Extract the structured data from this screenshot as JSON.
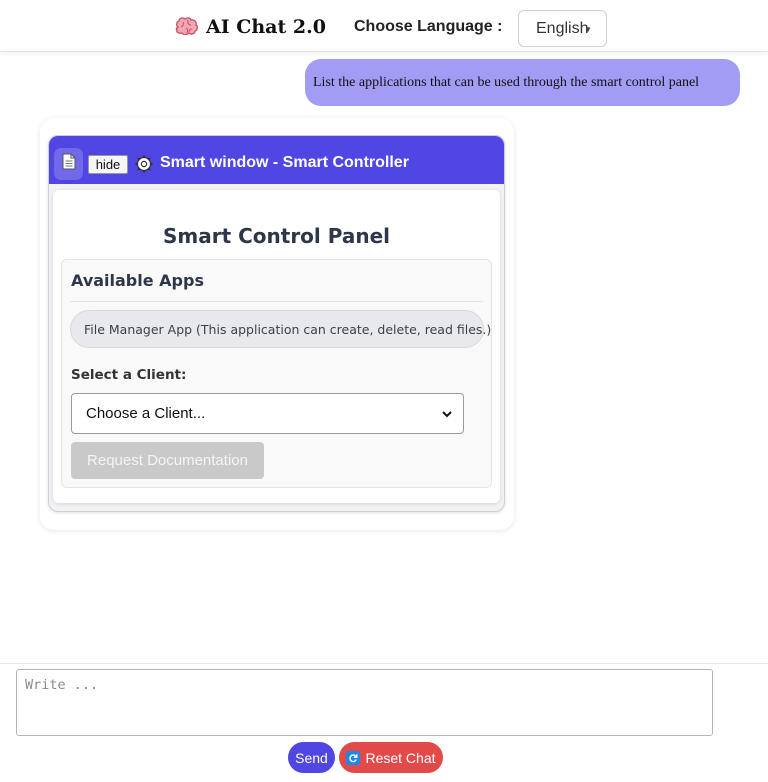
{
  "header": {
    "brand_icon": "brain-icon",
    "title": "AI Chat 2.0",
    "language_label": "Choose Language :",
    "language_selected": "English"
  },
  "chat": {
    "user_message": "List the applications that can be used through the smart control panel",
    "widget": {
      "document_icon": "document-icon",
      "hide_label": "hide",
      "settings_icon": "gear-icon",
      "title": "Smart window - Smart Controller",
      "panel_title": "Smart Control Panel",
      "apps_heading": "Available Apps",
      "apps": [
        "File Manager App (This application can create, delete, read files.)"
      ],
      "client_label": "Select a Client:",
      "client_selected": "Choose a Client...",
      "request_button": "Request Documentation"
    }
  },
  "composer": {
    "placeholder": "Write ...",
    "send_label": "Send",
    "reset_label": "Reset Chat",
    "reset_icon": "refresh-icon"
  },
  "colors": {
    "accent": "#5046e4",
    "user_bubble": "#a39cf5",
    "reset": "#e24a4a",
    "disabled_button": "#c9c9c9"
  }
}
